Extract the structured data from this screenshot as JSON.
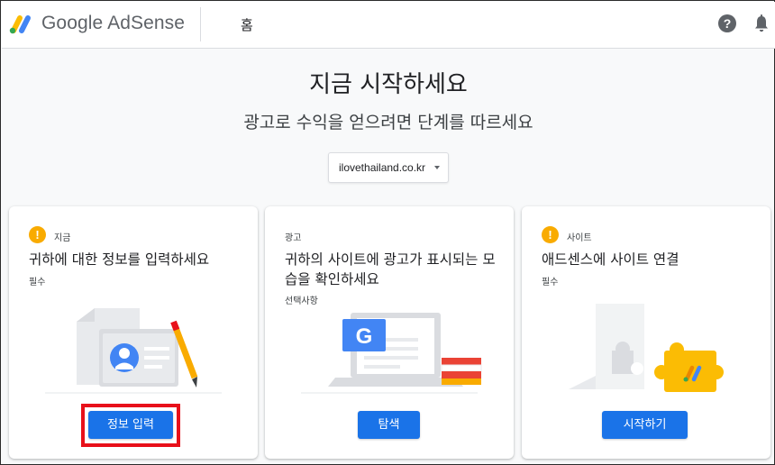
{
  "header": {
    "brand": "Google AdSense",
    "page": "홈",
    "help_symbol": "?"
  },
  "hero": {
    "title": "지금 시작하세요",
    "subtitle": "광고로 수익을 얻으려면 단계를 따르세요"
  },
  "site_selector": {
    "value": "ilovethailand.co.kr"
  },
  "cards": [
    {
      "tag": "지금",
      "title": "귀하에 대한 정보를 입력하세요",
      "note": "필수",
      "button": "정보 입력"
    },
    {
      "tag": "광고",
      "title": "귀하의 사이트에 광고가 표시되는 모습을 확인하세요",
      "note": "선택사항",
      "button": "탐색"
    },
    {
      "tag": "사이트",
      "title": "애드센스에 사이트 연결",
      "note": "필수",
      "button": "시작하기"
    }
  ],
  "colors": {
    "accent": "#1a73e8",
    "warning": "#f9ab00",
    "highlight": "#e8101a"
  },
  "icons": {
    "logo": "adsense-logo-icon",
    "help": "help-circle-icon",
    "notifications": "bell-icon",
    "warning": "warning-circle-icon"
  }
}
